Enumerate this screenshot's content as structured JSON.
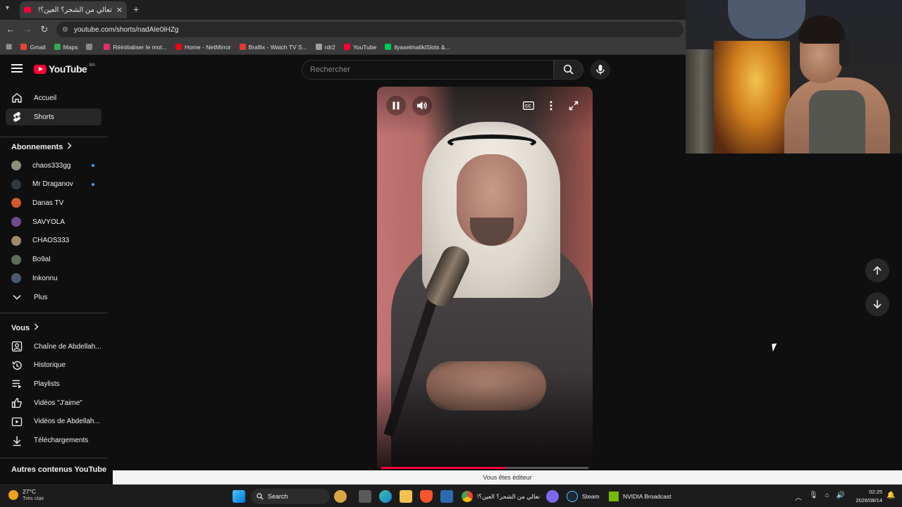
{
  "browser": {
    "tab_title": "تعالي من الشحر؟ العين؟!",
    "tab_close": "✕",
    "new_tab": "+",
    "url": "youtube.com/shorts/nadAIe0iHZg",
    "bookmarks": [
      {
        "label": "Gmail",
        "color": "#ea4335"
      },
      {
        "label": "Maps",
        "color": "#34a853"
      },
      {
        "label": "",
        "color": "#888888"
      },
      {
        "label": "Réinitialiser le mot...",
        "color": "#e1306c"
      },
      {
        "label": "Home - NetMirror",
        "color": "#e50914"
      },
      {
        "label": "Braflix - Watch TV S...",
        "color": "#e53935"
      },
      {
        "label": "rdr2",
        "color": "#9e9e9e"
      },
      {
        "label": "YouTube",
        "color": "#ff0033"
      },
      {
        "label": "ilyaselmalikiSlots &...",
        "color": "#00c853"
      }
    ]
  },
  "youtube": {
    "logo_text": "YouTube",
    "country_code": "MA",
    "search_placeholder": "Rechercher",
    "accent": "#ff0033",
    "progress_fraction": 0.6
  },
  "sidebar": {
    "main": [
      {
        "label": "Accueil",
        "icon": "home-icon"
      },
      {
        "label": "Shorts",
        "icon": "shorts-icon",
        "active": true
      }
    ],
    "subscriptions_heading": "Abonnements",
    "subscriptions": [
      {
        "label": "chaos333gg",
        "new": true,
        "color": "#8a8f7a"
      },
      {
        "label": "Mr Draganov",
        "new": true,
        "color": "#2f3a44"
      },
      {
        "label": "Danas TV",
        "new": false,
        "color": "#d35a2c"
      },
      {
        "label": "SAVYOLA",
        "new": false,
        "color": "#6e4b8a"
      },
      {
        "label": "CHAOS333",
        "new": false,
        "color": "#9c8c6a"
      },
      {
        "label": "Bo9al",
        "new": false,
        "color": "#5e6e5a"
      },
      {
        "label": "Inkonnu",
        "new": false,
        "color": "#4a5a6e"
      }
    ],
    "more_label": "Plus",
    "you_heading": "Vous",
    "you_items": [
      {
        "label": "Chaîne de Abdellah...",
        "icon": "channel-icon"
      },
      {
        "label": "Historique",
        "icon": "history-icon"
      },
      {
        "label": "Playlists",
        "icon": "playlists-icon"
      },
      {
        "label": "Vidéos \"J'aime\"",
        "icon": "thumbs-up-icon"
      },
      {
        "label": "Vidéos de Abdellah...",
        "icon": "your-videos-icon"
      },
      {
        "label": "Téléchargements",
        "icon": "download-icon"
      }
    ],
    "other_heading": "Autres contenus YouTube"
  },
  "status_bar": "Vous êtes éditeur",
  "taskbar": {
    "temperature": "27°C",
    "weather_text": "Très clair",
    "search_label": "Search",
    "chrome_task_title": "تعالي من الشحر؟ العين؟!",
    "steam_label": "Steam",
    "nvidia_label": "NVIDIA Broadcast",
    "time": "02:25",
    "date": "2026/08/14"
  }
}
